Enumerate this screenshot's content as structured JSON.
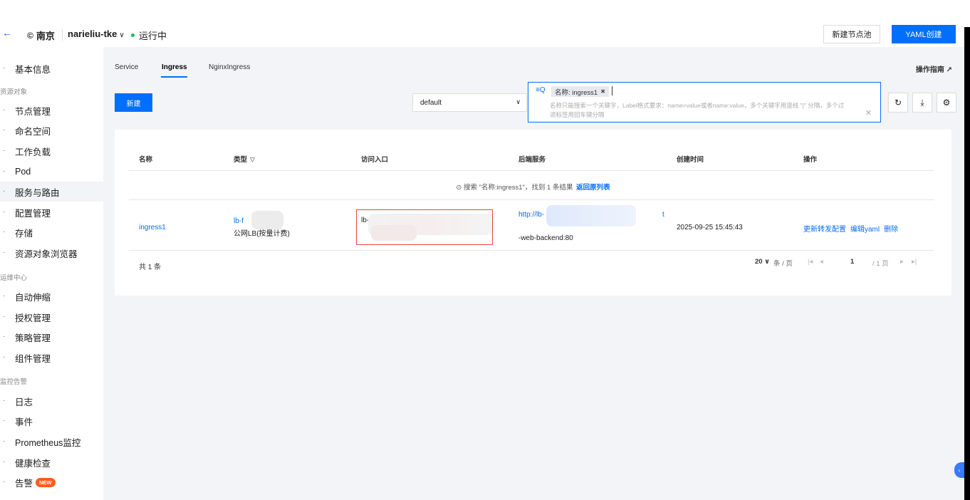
{
  "topbar": {
    "region": "南京",
    "cluster": "narieliu-tke",
    "status": "运行中",
    "new_pool_label": "新建节点池",
    "yaml_create_label": "YAML创建"
  },
  "sidebar": {
    "items": [
      {
        "label": "基本信息"
      },
      {
        "group": "资源对象"
      },
      {
        "label": "节点管理"
      },
      {
        "label": "命名空间"
      },
      {
        "label": "工作负载"
      },
      {
        "label": "Pod"
      },
      {
        "label": "服务与路由"
      },
      {
        "label": "配置管理"
      },
      {
        "label": "存储"
      },
      {
        "label": "资源对象浏览器"
      },
      {
        "group": "运维中心"
      },
      {
        "label": "自动伸缩"
      },
      {
        "label": "授权管理"
      },
      {
        "label": "策略管理"
      },
      {
        "label": "组件管理"
      },
      {
        "group": "监控告警"
      },
      {
        "label": "日志"
      },
      {
        "label": "事件"
      },
      {
        "label": "Prometheus监控"
      },
      {
        "label": "健康检查"
      },
      {
        "label": "告警"
      }
    ],
    "new_badge": "NEW"
  },
  "tabs": {
    "service": "Service",
    "ingress": "Ingress",
    "nginx": "NginxIngress",
    "guide": "操作指南"
  },
  "toolbar": {
    "new_label": "新建",
    "namespace": "default",
    "search_tag": "名称: ingress1",
    "search_hint": "名称只能搜索一个关键字，Label格式要求：name=value或者name:value，多个关键字用竖线 \"|\" 分隔，多个过滤标签用回车键分隔"
  },
  "table": {
    "headers": {
      "name": "名称",
      "type": "类型",
      "entry": "访问入口",
      "backend": "后端服务",
      "created": "创建时间",
      "ops": "操作"
    },
    "search_info": "搜索 \"名称:ingress1\"，找到 1 条结果",
    "back_to_list": "返回原列表",
    "row": {
      "name": "ingress1",
      "type_line1": "lb-f",
      "type_line2": "公网LB(按量计费)",
      "entry": "lb-fwj",
      "backend_url": "http://lb-",
      "backend_t": "t",
      "backend_service": "-web-backend:80",
      "created": "2025-09-25 15:45:43",
      "op1": "更新转发配置",
      "op2": "编辑yaml",
      "op3": "删除"
    },
    "total": "共 1 条",
    "page_size": "20",
    "per_page_text": "条 / 页",
    "page": "1",
    "total_pages": "/ 1 页"
  },
  "colors": {
    "accent": "#006eff",
    "running": "#0abf5b",
    "highlight_border": "#e54545",
    "new_badge": "#ff5b1e"
  }
}
